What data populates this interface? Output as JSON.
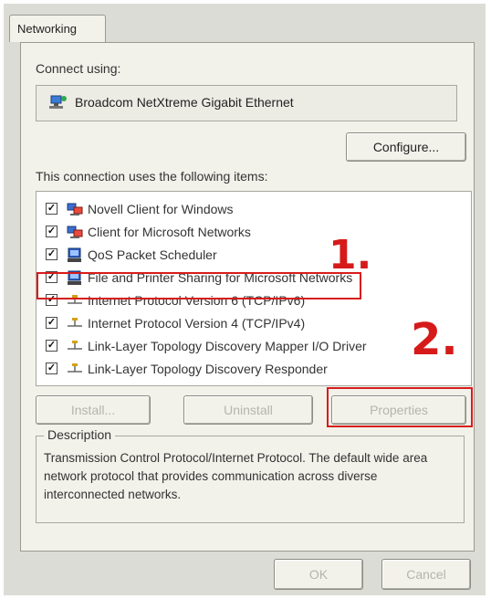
{
  "tab": {
    "label": "Networking"
  },
  "connect_using": {
    "label": "Connect using:",
    "adapter_name": "Broadcom NetXtreme Gigabit Ethernet",
    "configure_label": "Configure..."
  },
  "items_label": "This connection uses the following items:",
  "items": [
    {
      "label": "Novell Client for Windows",
      "checked": true,
      "icon": "network-client-icon"
    },
    {
      "label": "Client for Microsoft Networks",
      "checked": true,
      "icon": "network-client-icon"
    },
    {
      "label": "QoS Packet Scheduler",
      "checked": true,
      "icon": "service-icon"
    },
    {
      "label": "File and Printer Sharing for Microsoft Networks",
      "checked": true,
      "icon": "service-icon"
    },
    {
      "label": "Internet Protocol Version 6 (TCP/IPv6)",
      "checked": true,
      "icon": "protocol-icon"
    },
    {
      "label": "Internet Protocol Version 4 (TCP/IPv4)",
      "checked": true,
      "icon": "protocol-icon"
    },
    {
      "label": "Link-Layer Topology Discovery Mapper I/O Driver",
      "checked": true,
      "icon": "protocol-icon"
    },
    {
      "label": "Link-Layer Topology Discovery Responder",
      "checked": true,
      "icon": "protocol-icon"
    }
  ],
  "buttons": {
    "install": "Install...",
    "uninstall": "Uninstall",
    "properties": "Properties",
    "ok": "OK",
    "cancel": "Cancel"
  },
  "description": {
    "legend": "Description",
    "text": "Transmission Control Protocol/Internet Protocol. The default wide area network protocol that provides communication across diverse interconnected networks."
  },
  "annotations": {
    "step1": "1.",
    "step2": "2."
  },
  "colors": {
    "annotation_red": "#d81c1c",
    "dialog_bg": "#f2f1ea"
  }
}
